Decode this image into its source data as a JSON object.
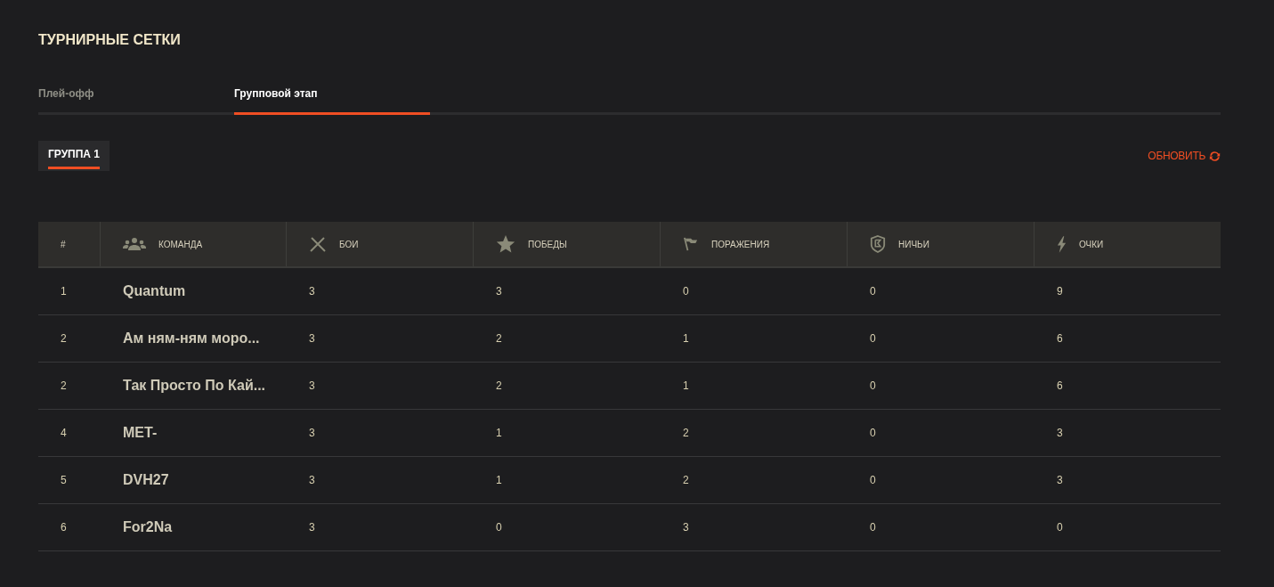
{
  "title": "ТУРНИРНЫЕ СЕТКИ",
  "tabs": [
    {
      "label": "Плей-офф",
      "selected": false
    },
    {
      "label": "Групповой этап",
      "selected": true
    }
  ],
  "groups": [
    {
      "label": "ГРУППА 1",
      "selected": true
    }
  ],
  "refresh": {
    "label": "ОБНОВИТЬ"
  },
  "table": {
    "columns": [
      {
        "label": "#",
        "kind": "rank"
      },
      {
        "label": "КОМАНДА",
        "kind": "team"
      },
      {
        "label": "БОИ",
        "kind": "battles"
      },
      {
        "label": "ПОБЕДЫ",
        "kind": "wins"
      },
      {
        "label": "ПОРАЖЕНИЯ",
        "kind": "losses"
      },
      {
        "label": "НИЧЬИ",
        "kind": "draws"
      },
      {
        "label": "ОЧКИ",
        "kind": "points"
      }
    ],
    "rows": [
      [
        "1",
        "Quantum",
        "3",
        "3",
        "0",
        "0",
        "9"
      ],
      [
        "2",
        "Ам ням-ням моро...",
        "3",
        "2",
        "1",
        "0",
        "6"
      ],
      [
        "2",
        "Так Просто По Кай...",
        "3",
        "2",
        "1",
        "0",
        "6"
      ],
      [
        "4",
        "MET-",
        "3",
        "1",
        "2",
        "0",
        "3"
      ],
      [
        "5",
        "DVH27",
        "3",
        "1",
        "2",
        "0",
        "3"
      ],
      [
        "6",
        "For2Na",
        "3",
        "0",
        "3",
        "0",
        "0"
      ]
    ]
  }
}
